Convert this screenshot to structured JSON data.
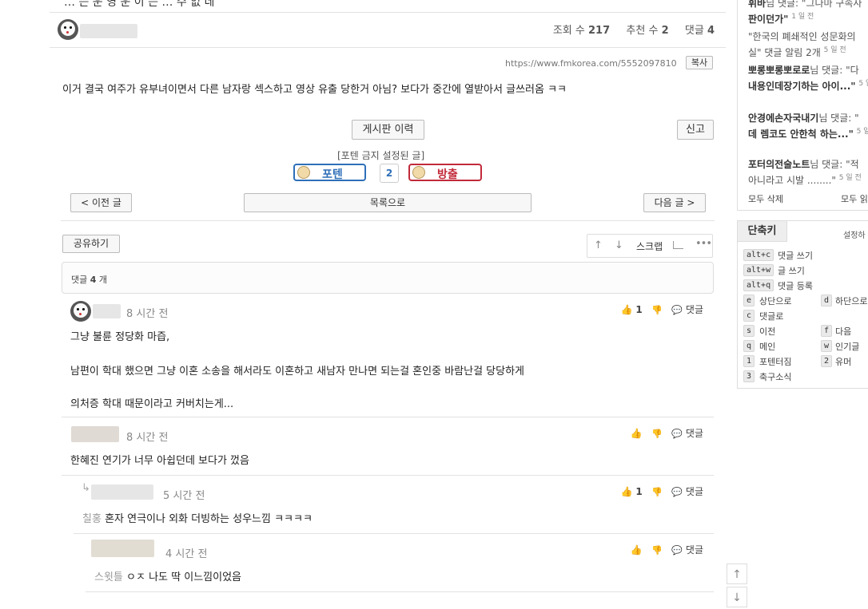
{
  "post": {
    "title_partial": "… 는 운 영 운  이 는 …  수 없 네",
    "views_label": "조회 수",
    "views": "217",
    "recommend_label": "추천 수",
    "recommend": "2",
    "comments_label": "댓글",
    "comments": "4",
    "url": "https://www.fmkorea.com/5552097810",
    "copy_label": "복사",
    "body": "이거 결국 여주가 유부녀이면서 다른 남자랑 섹스하고 영상 유출 당한거 아님? 보다가 중간에 열받아서 글쓰러옴 ㅋㅋ",
    "history_label": "게시판 이력",
    "report_label": "신고",
    "forbidden_label": "[포텐 금지 설정된 글]",
    "poten_label": "포텐",
    "vote_count": "2",
    "bangchul_label": "방출",
    "prev_label": "< 이전 글",
    "list_label": "목록으로",
    "next_label": "다음 글 >",
    "share_label": "공유하기",
    "scrap_label": "스크랩",
    "comment_count_prefix": "댓글",
    "comment_count": "4",
    "comment_count_suffix": "개"
  },
  "comments": [
    {
      "time": "8 시간 전",
      "likes": "1",
      "reply_label": "댓글",
      "lines": [
        "그냥 불륜 정당화 마즙,",
        "남편이 학대 했으면 그냥 이혼 소송을 해서라도 이혼하고 새남자 만나면 되는걸 혼인중 바람난걸 당당하게",
        "의처증 학대 때문이라고 커버치는게..."
      ]
    },
    {
      "time": "8 시간 전",
      "likes": "",
      "reply_label": "댓글",
      "lines": [
        "한혜진 연기가 너무 아쉽던데 보다가 껐음"
      ]
    },
    {
      "time": "5 시간 전",
      "likes": "1",
      "reply_label": "댓글",
      "mention": "칠홍",
      "lines": [
        "혼자 연극이나 외화 더빙하는 성우느낌 ㅋㅋㅋㅋ"
      ]
    },
    {
      "time": "4 시간 전",
      "likes": "",
      "reply_label": "댓글",
      "mention": "스윗틀",
      "lines": [
        "ㅇㅈ 나도 딱 이느낌이었음"
      ]
    }
  ],
  "sidebar": {
    "notifications": [
      {
        "user": "휘바",
        "text": "님 댓글: \"그나마 구속사",
        "cont": "판이던가\"",
        "ago": "1 일 전"
      },
      {
        "user": "",
        "text": "\"한국의 폐쇄적인 성문화의",
        "cont": "실\" 댓글 알림 2개",
        "ago": "5 일 전"
      },
      {
        "user": "뽀롱뽀롱뽀로로",
        "text": "님 댓글: \"다",
        "cont": "내용인데장기하는 아이...\"",
        "ago": "5 일 전"
      },
      {
        "user": "안경에손자국내기",
        "text": "님 댓글: \"",
        "cont": "데 렘코도 안한척 하는...\"",
        "ago": "5 일 전"
      },
      {
        "user": "포터의전술노트",
        "text": "님 댓글: \"적",
        "cont": "아니라고 시발 ........\"",
        "ago": "5 일 전"
      }
    ],
    "delete_all": "모두 삭제",
    "read_all": "모두 읽",
    "shortcut_title": "단축키",
    "settings_label": "설정하",
    "shortcuts": [
      {
        "key": "alt+c",
        "label": "댓글 쓰기"
      },
      {
        "key": "alt+w",
        "label": "글 쓰기"
      },
      {
        "key": "alt+q",
        "label": "댓글 등록"
      },
      {
        "key": "e",
        "label": "상단으로",
        "key2": "d",
        "label2": "하단으로"
      },
      {
        "key": "c",
        "label": "댓글로"
      },
      {
        "key": "s",
        "label": "이전",
        "key2": "f",
        "label2": "다음"
      },
      {
        "key": "q",
        "label": "메인",
        "key2": "w",
        "label2": "인기글"
      },
      {
        "key": "1",
        "label": "포텐터짐",
        "key2": "2",
        "label2": "유머"
      },
      {
        "key": "3",
        "label": "축구소식"
      }
    ]
  },
  "colors": {
    "poten_blue": "#2e6fb8",
    "bangchul_red": "#c22a3a",
    "accent": "#1a6fc4"
  }
}
